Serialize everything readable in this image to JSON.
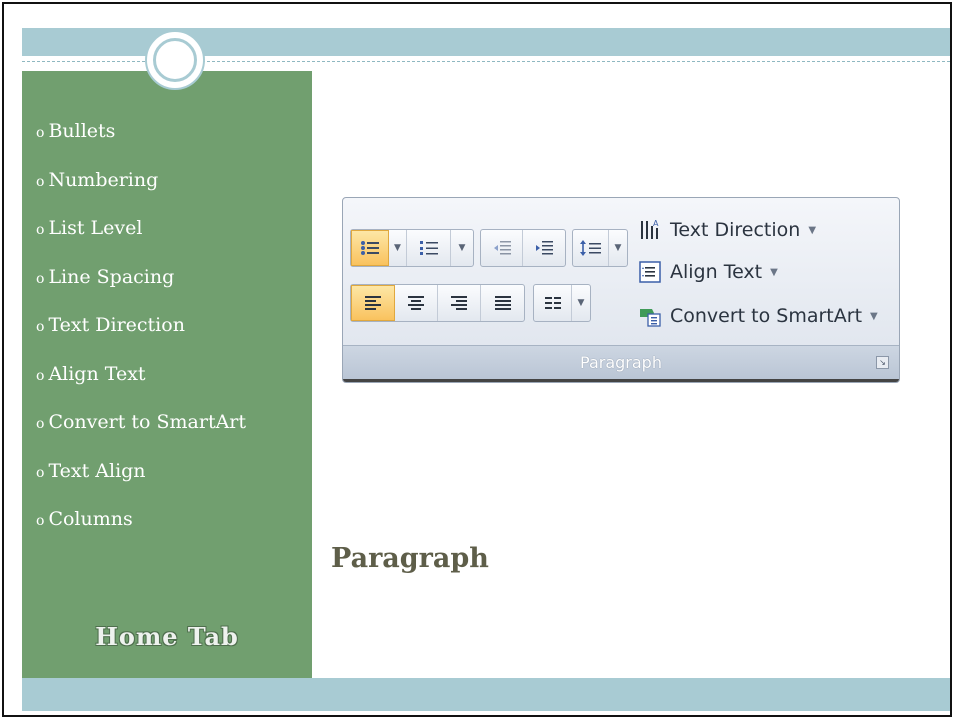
{
  "sidebar": {
    "bullet_marker": "o",
    "items": [
      "Bullets",
      "Numbering",
      "List Level",
      "Line Spacing",
      "Text Direction",
      "Align Text",
      "Convert to SmartArt",
      "Text Align",
      "Columns"
    ],
    "footer": "Home Tab"
  },
  "slide": {
    "title": "Paragraph"
  },
  "ribbon": {
    "group_label": "Paragraph",
    "commands": {
      "text_direction": "Text Direction",
      "align_text": "Align Text",
      "convert_smartart": "Convert to SmartArt"
    },
    "icons": [
      "bullets-icon",
      "numbering-icon",
      "decrease-indent-icon",
      "increase-indent-icon",
      "line-spacing-icon",
      "align-left-icon",
      "center-icon",
      "align-right-icon",
      "justify-icon",
      "columns-icon",
      "text-direction-icon",
      "align-text-icon",
      "smartart-icon",
      "dialog-launcher-icon"
    ]
  },
  "colors": {
    "sidebar": "#719f6f",
    "band": "#a8cbd3",
    "title": "#5e5e49",
    "active_button": "#f9c25e"
  }
}
